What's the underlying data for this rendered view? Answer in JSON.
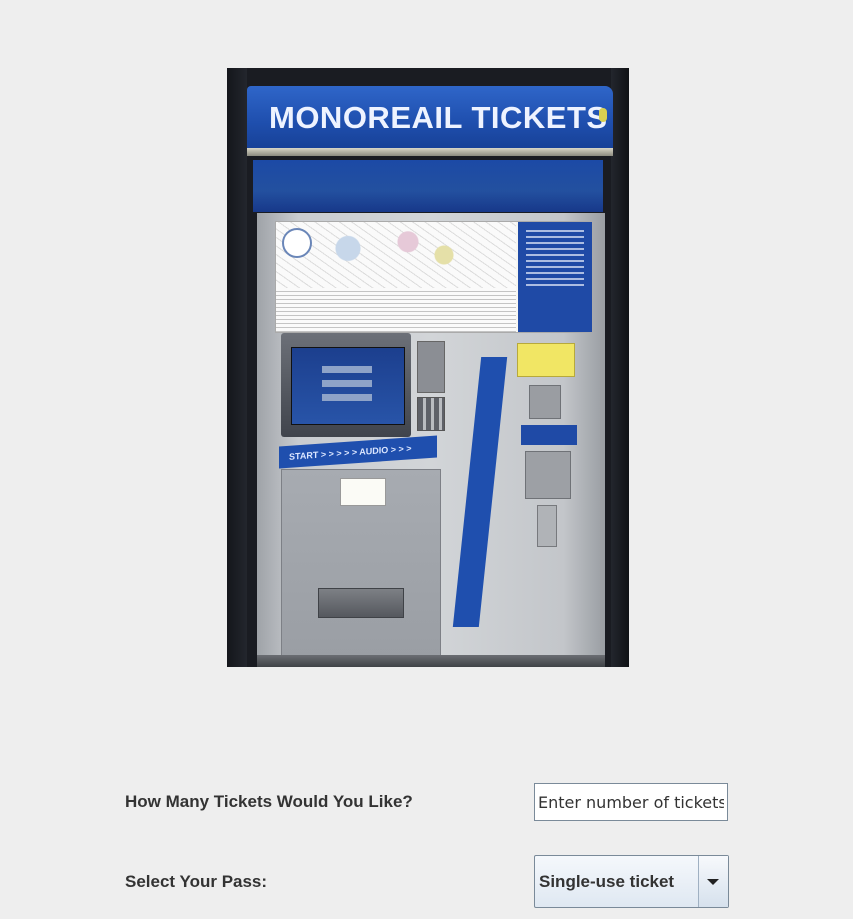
{
  "photo": {
    "sign_text": "MONOREAIL TICKETS",
    "startbar_text": "START > > > > > AUDIO > > >"
  },
  "form": {
    "tickets_label": "How Many Tickets Would You Like?",
    "tickets_placeholder": "Enter number of tickets",
    "pass_label": "Select Your Pass:",
    "pass_selected": "Single-use ticket"
  },
  "icons": {
    "dropdown": "chevron-down-icon"
  }
}
